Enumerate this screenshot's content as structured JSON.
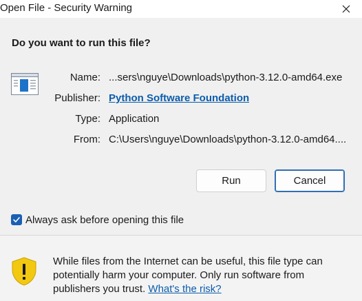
{
  "window": {
    "title": "Open File - Security Warning"
  },
  "dialog": {
    "question": "Do you want to run this file?",
    "fields": {
      "name_label": "Name:",
      "name_value": "...sers\\nguye\\Downloads\\python-3.12.0-amd64.exe",
      "publisher_label": "Publisher:",
      "publisher_value": "Python Software Foundation",
      "type_label": "Type:",
      "type_value": "Application",
      "from_label": "From:",
      "from_value": "C:\\Users\\nguye\\Downloads\\python-3.12.0-amd64...."
    },
    "buttons": {
      "run_label": "Run",
      "cancel_label": "Cancel"
    },
    "checkbox": {
      "label": "Always ask before opening this file",
      "checked": true
    }
  },
  "footer": {
    "warning_text": "While files from the Internet can be useful, this file type can potentially harm your computer. Only run software from publishers you trust.",
    "risk_link": "What's the risk?"
  },
  "colors": {
    "accent": "#1a5fb4",
    "link": "#0b5cad",
    "shield_yellow": "#f2c811"
  }
}
